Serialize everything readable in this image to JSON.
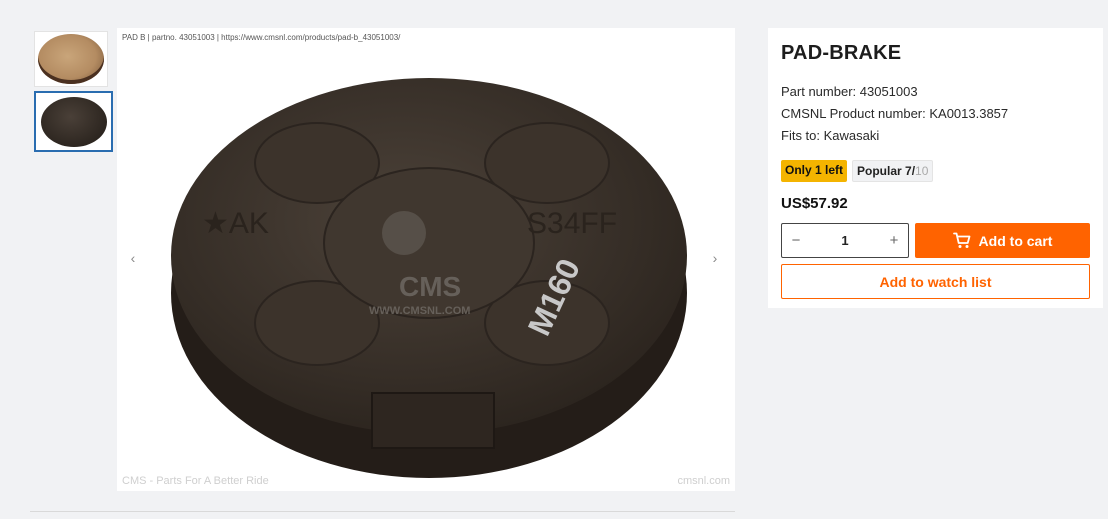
{
  "gallery": {
    "caption": "PAD B | partno. 43051003  | https://www.cmsnl.com/products/pad-b_43051003/",
    "watermark_left": "CMS - Parts For A Better Ride",
    "watermark_right": "cmsnl.com",
    "logo_text": "CMS",
    "logo_url": "WWW.CMSNL.COM",
    "pad_marks": [
      "★AK",
      "S34FF",
      "M160"
    ],
    "prev_arrow": "‹",
    "next_arrow": "›"
  },
  "product": {
    "title": "PAD-BRAKE",
    "part_number": "Part number: 43051003",
    "cmsnl_number": "CMSNL Product number: KA0013.3857",
    "fits": "Fits to: Kawasaki",
    "stock_badge": "Only 1 left",
    "popular_label": "Popular 7/",
    "popular_max": "10",
    "price": "US$57.92",
    "quantity": "1",
    "minus": "−",
    "plus": "+",
    "add_to_cart": "Add to cart",
    "add_to_watch_list": "Add to watch list"
  },
  "colors": {
    "accent": "#ff6300",
    "stock_badge": "#f4b400",
    "thumb_active_border": "#2a6db0"
  },
  "icons": [
    "cart-icon",
    "chevron-left-icon",
    "chevron-right-icon"
  ]
}
